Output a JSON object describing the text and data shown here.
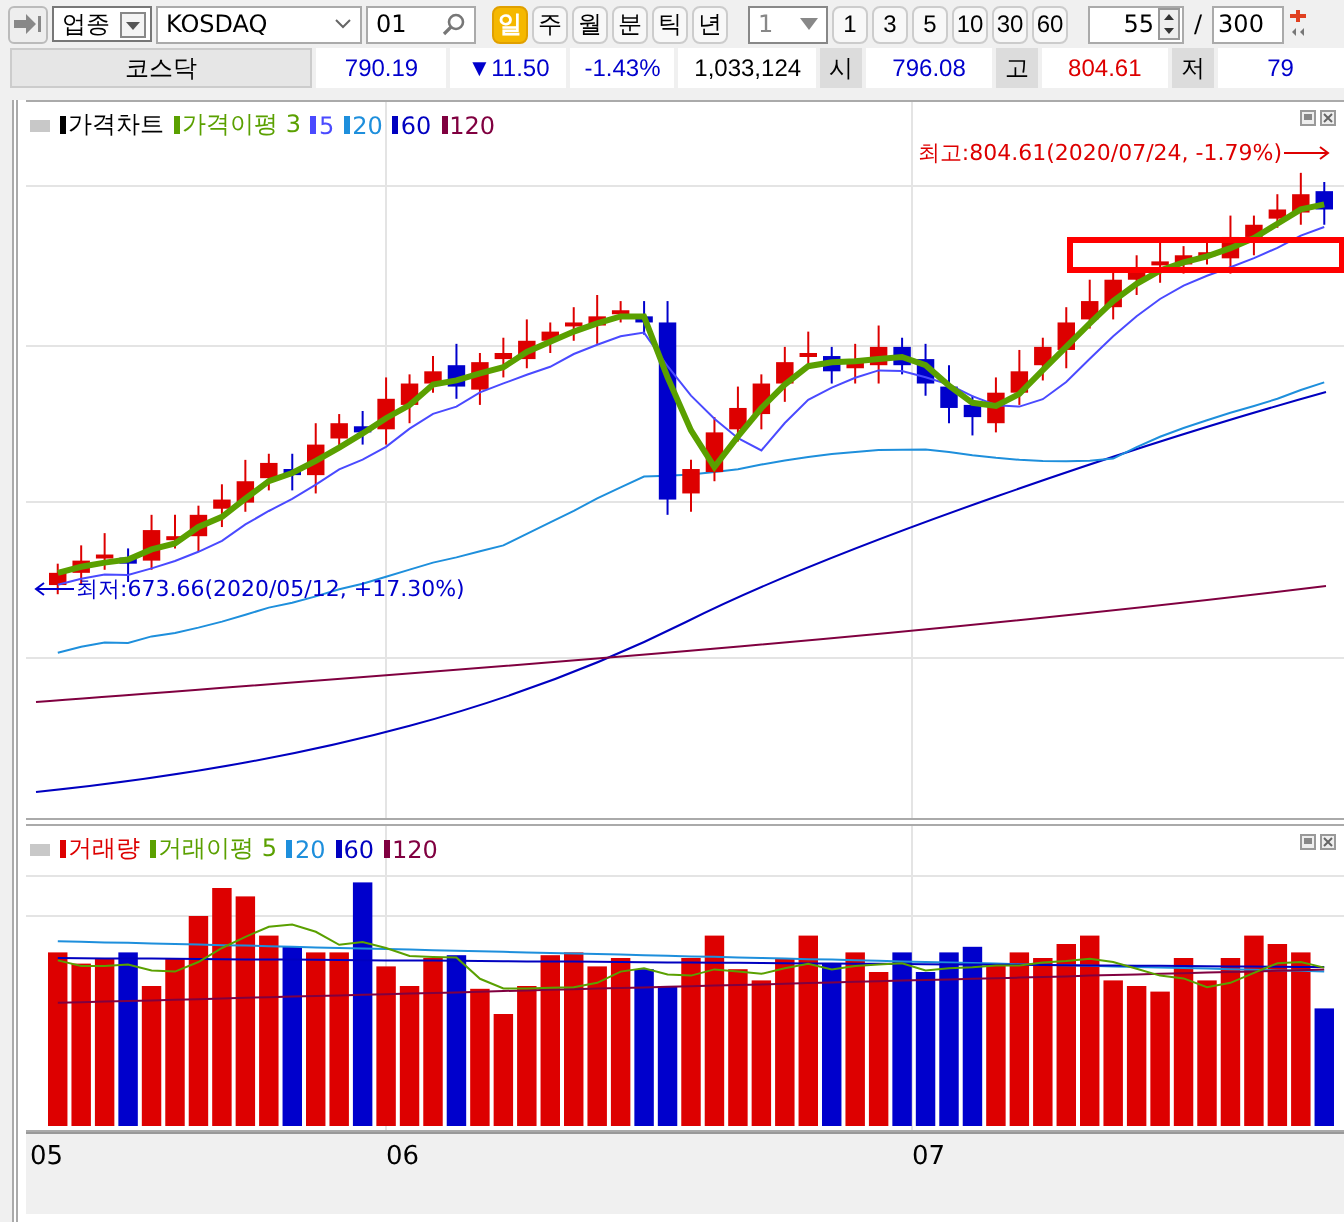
{
  "toolbar": {
    "market_type": "업종",
    "symbol": "KOSDAQ",
    "code": "01",
    "periods": [
      {
        "label": "일",
        "selected": true
      },
      {
        "label": "주",
        "selected": false
      },
      {
        "label": "월",
        "selected": false
      },
      {
        "label": "분",
        "selected": false
      },
      {
        "label": "틱",
        "selected": false
      },
      {
        "label": "년",
        "selected": false
      }
    ],
    "interval": "1",
    "interval_buttons": [
      "1",
      "3",
      "5",
      "10",
      "30",
      "60"
    ],
    "count": "55",
    "separator": "/",
    "max_count": "300"
  },
  "quote": {
    "name": "코스닥",
    "price": "790.19",
    "change": "▼11.50",
    "change_pct": "-1.43%",
    "volume": "1,033,124",
    "fields": [
      {
        "label": "시",
        "value": "796.08",
        "color": "#0000cc"
      },
      {
        "label": "고",
        "value": "804.61",
        "color": "#dd0000"
      },
      {
        "label": "저",
        "value": "79",
        "color": "#0000cc"
      }
    ]
  },
  "price_chart": {
    "legend": [
      {
        "label": "가격차트",
        "color": "#000000"
      },
      {
        "label": "가격이평 3",
        "color": "#5aa000"
      },
      {
        "label": "5",
        "color": "#4a4aff"
      },
      {
        "label": "20",
        "color": "#1e8fdc"
      },
      {
        "label": "60",
        "color": "#0000c0"
      },
      {
        "label": "120",
        "color": "#800040"
      }
    ],
    "high_label": "최고:804.61(2020/07/24, -1.79%)",
    "low_label": "최저:673.66(2020/05/12, +17.30%)"
  },
  "volume_chart": {
    "legend": [
      {
        "label": "거래량",
        "color": "#dd0000"
      },
      {
        "label": "거래이평 5",
        "color": "#5aa000"
      },
      {
        "label": "20",
        "color": "#1e8fdc"
      },
      {
        "label": "60",
        "color": "#0000c0"
      },
      {
        "label": "120",
        "color": "#800040"
      }
    ]
  },
  "x_axis": [
    "05",
    "06",
    "07"
  ]
}
